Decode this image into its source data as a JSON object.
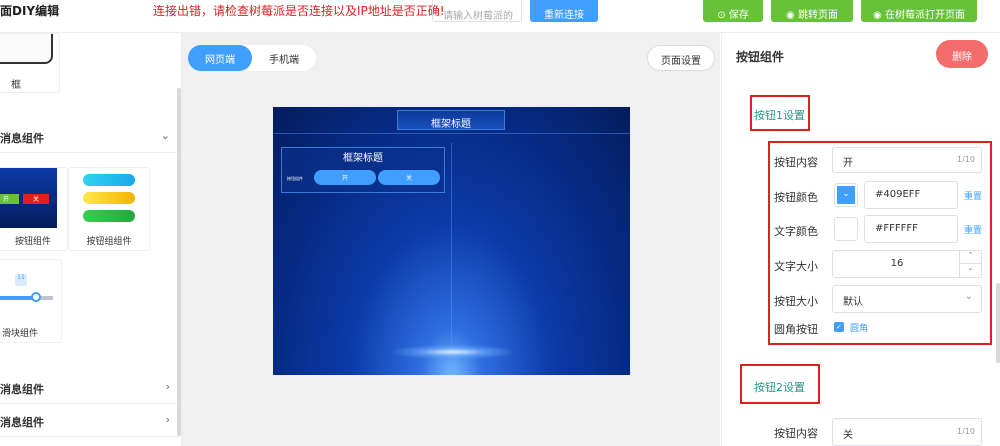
{
  "header": {
    "app_title": "页面DIY编辑",
    "error_message": "连接出错，请检查树莓派是否连接以及IP地址是否正确!",
    "ip_placeholder": "请输入树莓派的",
    "reconnect_label": "重新连接",
    "save_label": "保存",
    "goto_page_label": "跳转页面",
    "open_in_pi_label": "在树莓派打开页面"
  },
  "sidebar": {
    "frame_label": "框",
    "sections": [
      {
        "title": "消息组件",
        "expanded": true
      },
      {
        "title": "消息组件",
        "expanded": false
      },
      {
        "title": "消息组件",
        "expanded": false
      }
    ],
    "components": [
      {
        "label": "按钮组件",
        "preview_on": "开",
        "preview_off": "关"
      },
      {
        "label": "按钮组组件"
      },
      {
        "label": "滑块组件",
        "slider_value": "11"
      }
    ]
  },
  "center": {
    "tab_web": "网页端",
    "tab_mobile": "手机端",
    "page_settings_label": "页面设置",
    "canvas": {
      "main_title": "框架标题",
      "frame_title": "框架标题",
      "button_label": "按钮组件",
      "button_on": "开",
      "button_off": "关"
    }
  },
  "panel": {
    "title": "按钮组件",
    "delete_label": "删除",
    "section1_title": "按钮1设置",
    "section2_title": "按钮2设置",
    "content_label": "按钮内容",
    "content_value": "开",
    "content_count": "1/10",
    "bg_color_label": "按钮颜色",
    "bg_color_value": "#409EFF",
    "reset_label": "重置",
    "text_color_label": "文字颜色",
    "text_color_value": "#FFFFFF",
    "font_size_label": "文字大小",
    "font_size_value": "16",
    "size_label": "按钮大小",
    "size_value": "默认",
    "rounded_label": "圆角按钮",
    "rounded_option": "圆角",
    "btn2_content_value": "关",
    "btn2_content_count": "1/10"
  },
  "colors": {
    "primary": "#409EFF",
    "success": "#67C23A",
    "danger": "#F56C6C",
    "error_text": "#E02020",
    "section_title": "#1F9A8A"
  }
}
